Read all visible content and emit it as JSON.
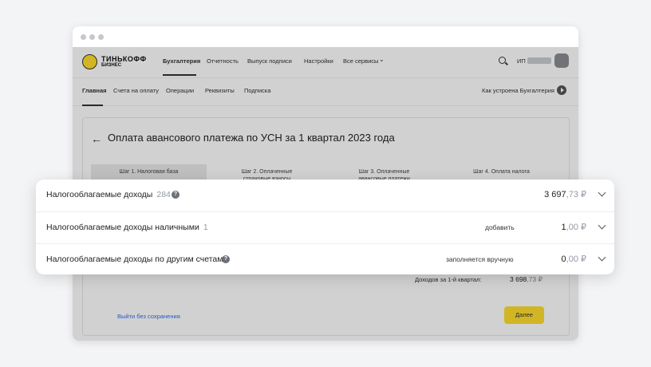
{
  "app": {
    "logo_title": "ТИНЬКОФФ",
    "logo_subtitle": "БИЗНЕС",
    "nav": [
      "Бухгалтерия",
      "Отчетность",
      "Выпуск подписи",
      "Настройки",
      "Все сервисы"
    ],
    "user_prefix": "ИП"
  },
  "subnav": {
    "items": [
      "Главная",
      "Счета на оплату",
      "Операции",
      "Реквизиты",
      "Подписка"
    ],
    "how_it_works": "Как устроена Бухгалтерия"
  },
  "page": {
    "title": "Оплата авансового платежа по УСН за 1 квартал 2023 года",
    "steps": [
      {
        "l1": "Шаг 1. Налоговая база",
        "l2": ""
      },
      {
        "l1": "Шаг 2. Оплаченные",
        "l2": "страховые взносы"
      },
      {
        "l1": "Шаг 3. Оплаченные",
        "l2": "авансовые платежи"
      },
      {
        "l1": "Шаг 4. Оплата налога",
        "l2": ""
      }
    ],
    "totals_label": "Доходов за 1-й квартал:",
    "totals_rub": "3 698",
    "totals_kop": ",73 ₽",
    "exit_label": "Выйти без сохранения",
    "next_label": "Далее"
  },
  "popup": {
    "rows": [
      {
        "label": "Налогооблагаемые доходы",
        "count": "284",
        "action": "",
        "amount_rub": "3 697",
        "amount_kop": ",73 ₽"
      },
      {
        "label": "Налогооблагаемые доходы наличными",
        "count": "1",
        "action": "добавить",
        "amount_rub": "1",
        "amount_kop": ",00 ₽"
      },
      {
        "label": "Налогооблагаемые доходы по другим счетам",
        "count": "",
        "action": "заполняется вручную",
        "amount_rub": "0",
        "amount_kop": ",00 ₽"
      }
    ]
  },
  "colors": {
    "accent_yellow": "#ffdd2d",
    "link_blue": "#336fee"
  }
}
